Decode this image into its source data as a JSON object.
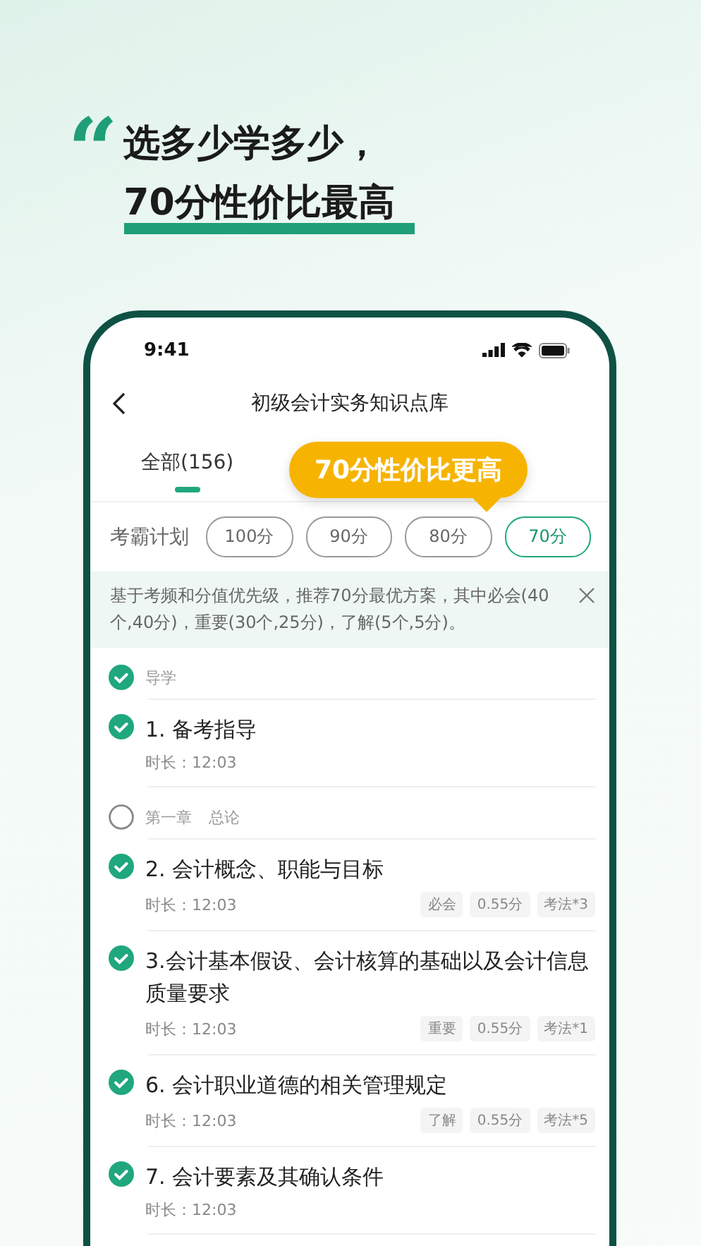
{
  "headline": {
    "quote_mark": "“",
    "lines": [
      "选多少学多少，",
      "70分性价比最高"
    ]
  },
  "phone": {
    "status_bar": {
      "time": "9:41"
    },
    "nav": {
      "title": "初级会计实务知识点库"
    },
    "tabs": [
      {
        "label": "全部(156)",
        "selected": true
      }
    ],
    "callout": "70分性价比更高",
    "plan": {
      "label": "考霸计划",
      "options": [
        {
          "label": "100分",
          "selected": false
        },
        {
          "label": "90分",
          "selected": false
        },
        {
          "label": "80分",
          "selected": false
        },
        {
          "label": "70分",
          "selected": true
        }
      ]
    },
    "notice": {
      "text": "基于考频和分值优先级，推荐70分最优方案，其中必会(40个,40分)，重要(30个,25分)，了解(5个,5分)。"
    },
    "sections": [
      {
        "title": "导学",
        "checked": true,
        "lessons": [
          {
            "title": "1. 备考指导",
            "duration": "时长：12:03",
            "checked": true
          }
        ]
      },
      {
        "chapter": "第一章",
        "title": "总论",
        "checked": false,
        "lessons": [
          {
            "title": "2. 会计概念、职能与目标",
            "duration": "时长：12:03",
            "checked": true,
            "tags": [
              "必会",
              "0.55分",
              "考法*3"
            ]
          },
          {
            "title": "3.会计基本假设、会计核算的基础以及会计信息质量要求",
            "duration": "时长：12:03",
            "checked": true,
            "tags": [
              "重要",
              "0.55分",
              "考法*1"
            ]
          },
          {
            "title": "6. 会计职业道德的相关管理规定",
            "duration": "时长：12:03",
            "checked": true,
            "tags": [
              "了解",
              "0.55分",
              "考法*5"
            ]
          },
          {
            "title": "7. 会计要素及其确认条件",
            "duration": "时长：12:03",
            "checked": true
          }
        ]
      }
    ]
  }
}
